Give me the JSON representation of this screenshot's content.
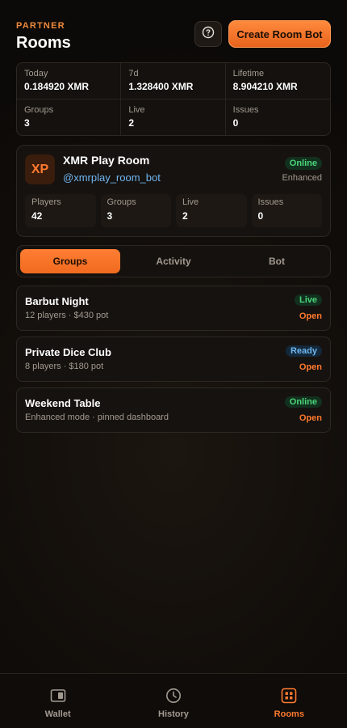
{
  "header": {
    "eyebrow": "PARTNER",
    "title": "Rooms",
    "help_icon": "help-circle-icon",
    "create_button_label": "Create Room Bot"
  },
  "stats": [
    {
      "label": "Today",
      "value": "0.184920 XMR"
    },
    {
      "label": "7d",
      "value": "1.328400 XMR"
    },
    {
      "label": "Lifetime",
      "value": "8.904210 XMR"
    },
    {
      "label": "Groups",
      "value": "3"
    },
    {
      "label": "Live",
      "value": "2"
    },
    {
      "label": "Issues",
      "value": "0"
    }
  ],
  "room": {
    "avatar_initials": "XP",
    "name": "XMR Play Room",
    "handle": "@xmrplay_room_bot",
    "status": "Online",
    "mode": "Enhanced",
    "stats": [
      {
        "label": "Players",
        "value": "42"
      },
      {
        "label": "Groups",
        "value": "3"
      },
      {
        "label": "Live",
        "value": "2"
      },
      {
        "label": "Issues",
        "value": "0"
      }
    ]
  },
  "tabs": [
    {
      "label": "Groups",
      "active": true
    },
    {
      "label": "Activity",
      "active": false
    },
    {
      "label": "Bot",
      "active": false
    }
  ],
  "groups": [
    {
      "title": "Barbut Night",
      "subtitle": "12 players · $430 pot",
      "status": "Live",
      "action": "Open"
    },
    {
      "title": "Private Dice Club",
      "subtitle": "8 players · $180 pot",
      "status": "Ready",
      "action": "Open"
    },
    {
      "title": "Weekend Table",
      "subtitle": "Enhanced mode · pinned dashboard",
      "status": "Online",
      "action": "Open"
    }
  ],
  "nav": [
    {
      "label": "Wallet",
      "icon": "wallet-icon",
      "active": false
    },
    {
      "label": "History",
      "icon": "clock-icon",
      "active": false
    },
    {
      "label": "Rooms",
      "icon": "grid-icon",
      "active": true
    }
  ],
  "colors": {
    "accent": "#ff7a2f",
    "live_green": "#4bd67a",
    "ready_blue": "#6fb6f0",
    "background": "#110d0a"
  }
}
